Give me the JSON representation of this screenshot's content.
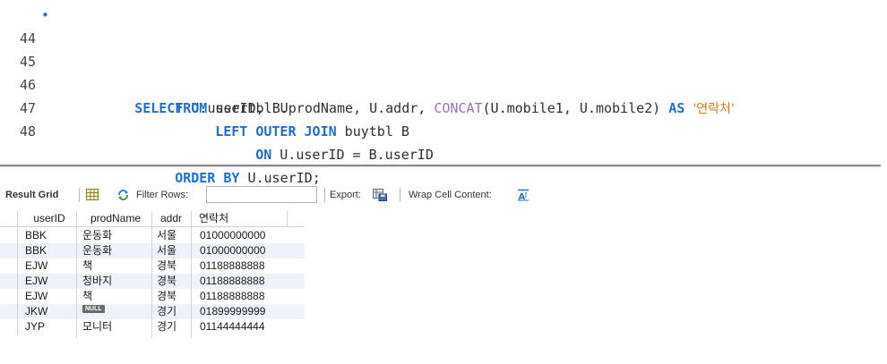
{
  "editor": {
    "lines": [
      {
        "num": "44",
        "marker": "•"
      },
      {
        "num": "45"
      },
      {
        "num": "46"
      },
      {
        "num": "47"
      },
      {
        "num": "48"
      }
    ],
    "tokens": {
      "select_kw": "SELECT",
      "select_cols": " U.userID, B.prodName, U.addr, ",
      "concat_fn": "CONCAT",
      "concat_args": "(U.mobile1, U.mobile2) ",
      "as_kw": "AS",
      "alias_str": "'연락처'",
      "from_kw": "FROM",
      "from_tbl": " usertbl U",
      "join_kw": "LEFT OUTER JOIN",
      "join_tbl": " buytbl B",
      "on_kw": "ON",
      "on_cond": " U.userID = B.userID",
      "order_kw": "ORDER BY",
      "order_col": " U.userID;"
    }
  },
  "toolbar": {
    "result_grid": "Result Grid",
    "filter_rows": "Filter Rows:",
    "export": "Export:",
    "wrap_cell": "Wrap Cell Content:"
  },
  "grid": {
    "columns": [
      "userID",
      "prodName",
      "addr",
      "연락처"
    ],
    "rows": [
      [
        "BBK",
        "운동화",
        "서울",
        "01000000000"
      ],
      [
        "BBK",
        "운동화",
        "서울",
        "01000000000"
      ],
      [
        "EJW",
        "책",
        "경북",
        "01188888888"
      ],
      [
        "EJW",
        "청바지",
        "경북",
        "01188888888"
      ],
      [
        "EJW",
        "책",
        "경북",
        "01188888888"
      ],
      [
        "JKW",
        "NULL",
        "경기",
        "01899999999"
      ],
      [
        "JYP",
        "모니터",
        "경기",
        "01144444444"
      ]
    ]
  },
  "colors": {
    "keyword": "#1e6fd0",
    "function": "#9b72b0",
    "string": "#d4792a",
    "row_alt": "#eef3fb"
  }
}
